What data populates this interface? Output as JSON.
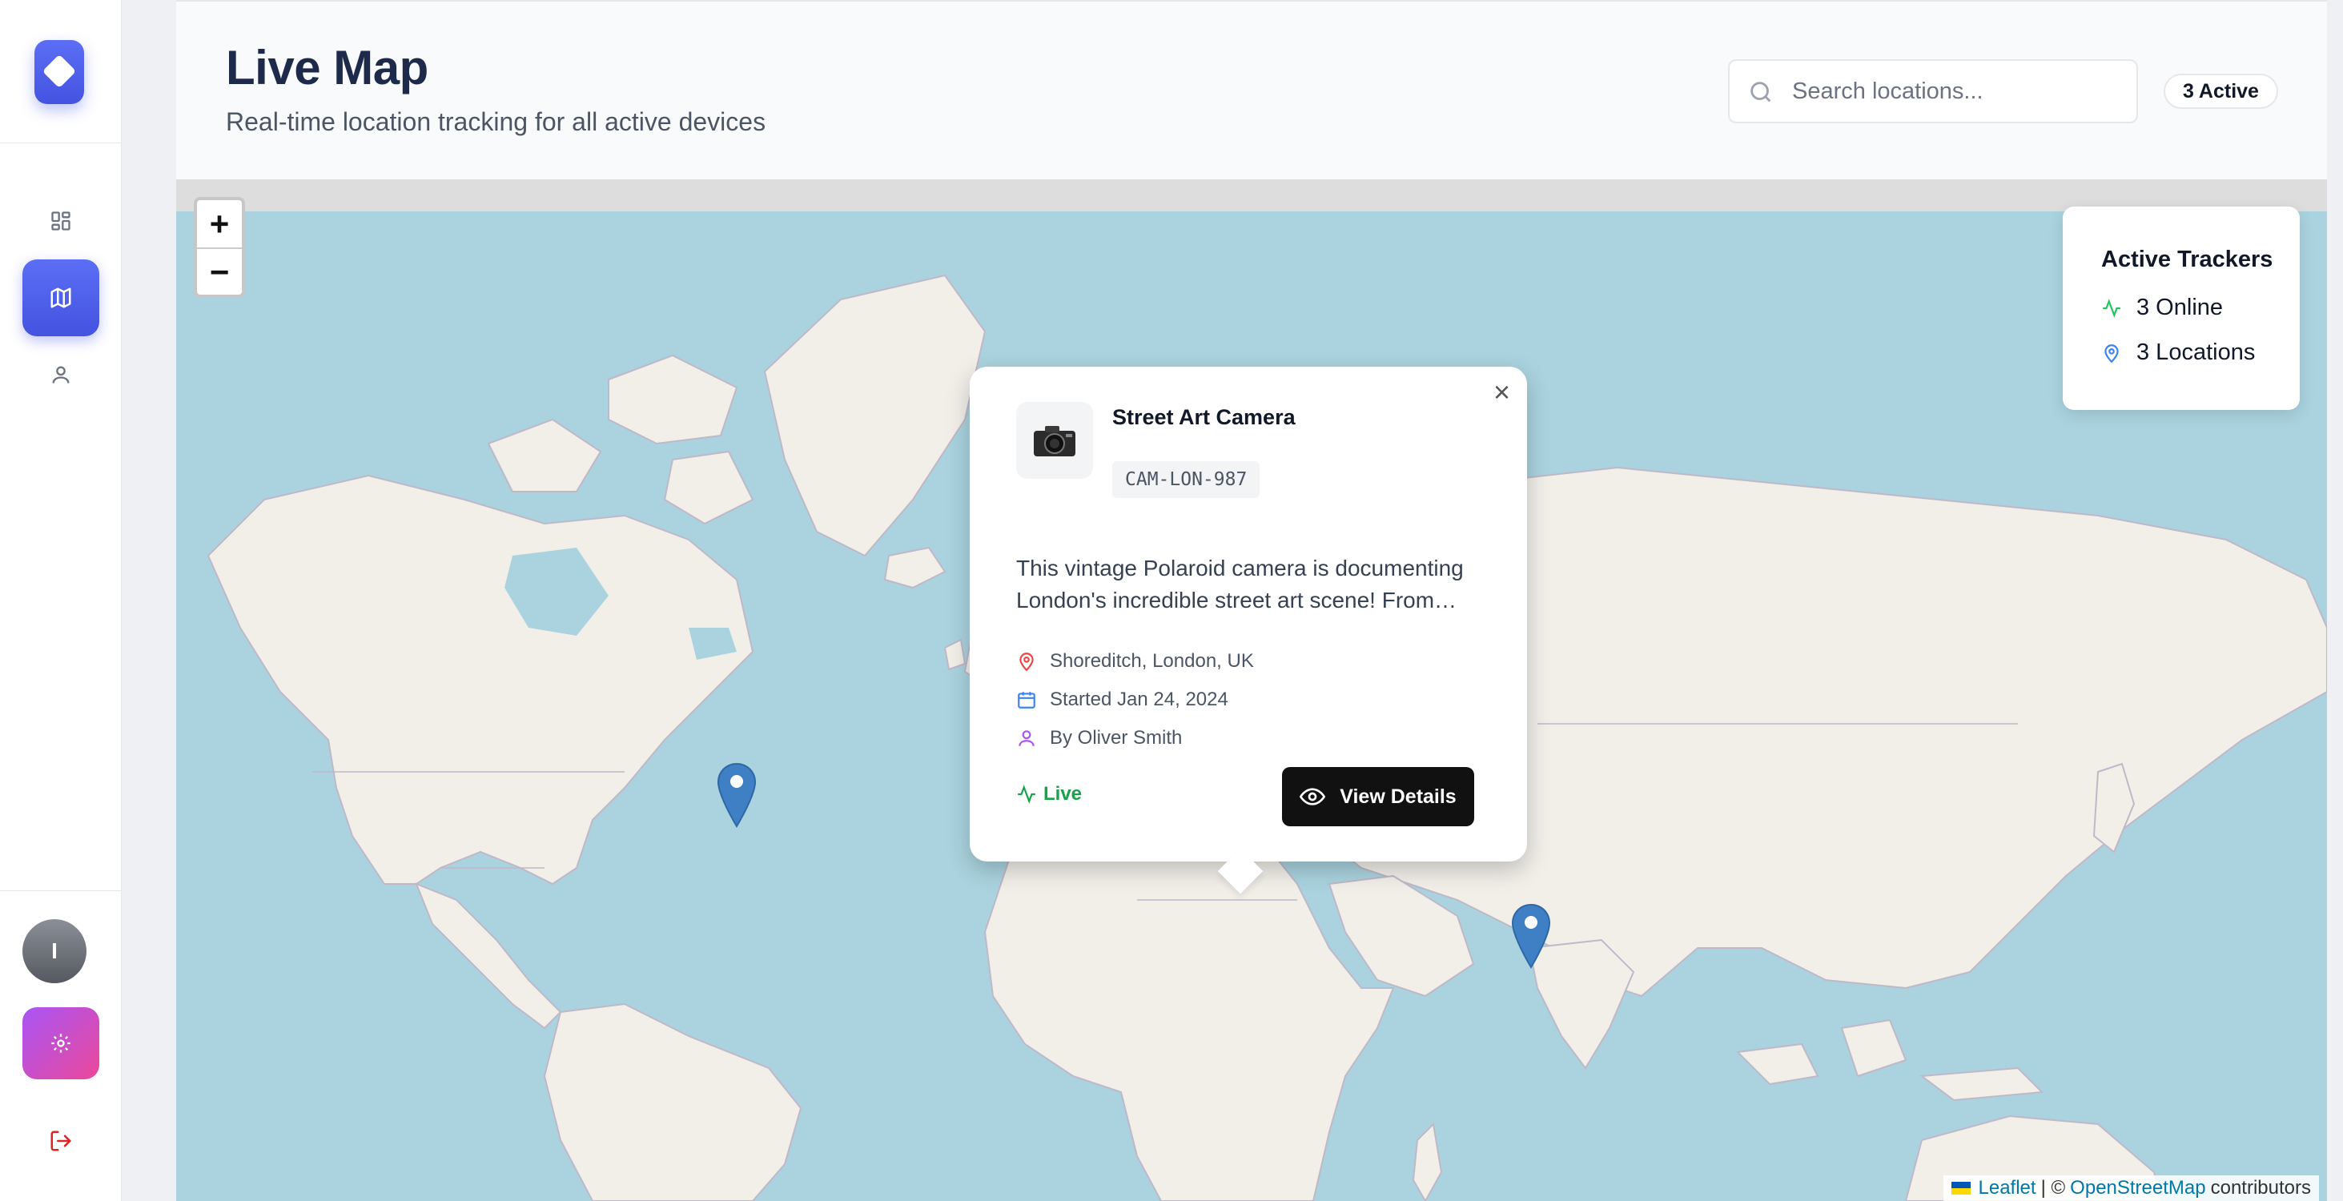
{
  "sidebar": {
    "avatar_initial": "I",
    "accent_color": "#4f5fef",
    "settings_color": "#c04fe8",
    "items": [
      {
        "name": "dashboard",
        "icon": "grid-icon",
        "active": false
      },
      {
        "name": "map",
        "icon": "map-icon",
        "active": true
      },
      {
        "name": "profile",
        "icon": "user-icon",
        "active": false
      }
    ]
  },
  "header": {
    "title": "Live Map",
    "subtitle": "Real-time location tracking for all active devices",
    "search_placeholder": "Search locations...",
    "active_badge": "3 Active"
  },
  "map": {
    "zoom_in_label": "+",
    "zoom_out_label": "−",
    "markers": [
      {
        "name": "new-york-marker"
      },
      {
        "name": "london-marker",
        "selected": true
      },
      {
        "name": "bangkok-marker"
      }
    ],
    "trackers_panel": {
      "title": "Active Trackers",
      "online": "3 Online",
      "locations": "3 Locations"
    },
    "attribution": {
      "leaflet": "Leaflet",
      "separator": "| ©",
      "osm": "OpenStreetMap",
      "suffix": "contributors"
    }
  },
  "popup": {
    "name": "Street Art Camera",
    "code": "CAM-LON-987",
    "description": "This vintage Polaroid camera is documenting London's incredible street art scene! From…",
    "location": "Shoreditch, London, UK",
    "started": "Started Jan 24, 2024",
    "owner": "By Oliver Smith",
    "status": "Live",
    "view_button": "View Details",
    "close_label": "×"
  }
}
